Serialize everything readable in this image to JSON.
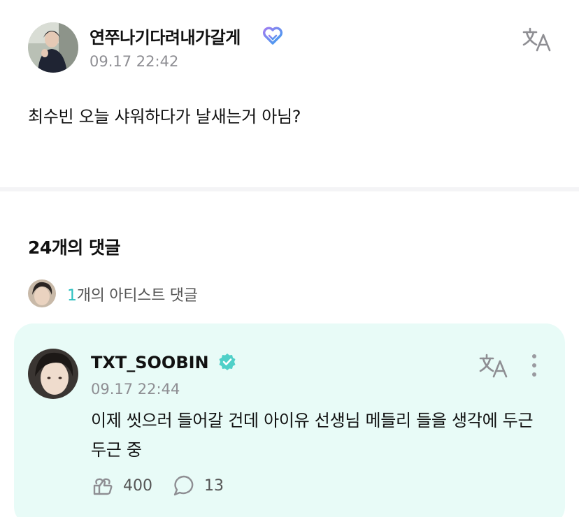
{
  "post": {
    "author": "연쭈나기다려내가갈게",
    "timestamp": "09.17 22:42",
    "body": "최수빈 오늘 샤워하다가 날새는거 아님?"
  },
  "comments": {
    "count_label": "24개의 댓글",
    "artist_summary": {
      "count": "1",
      "label": "개의 아티스트 댓글"
    },
    "featured": {
      "author": "TXT_SOOBIN",
      "timestamp": "09.17 22:44",
      "text": "이제 씻으러 들어갈 건데 아이유 선생님 메들리 들을 생각에 두근두근 중",
      "likes": "400",
      "replies": "13"
    }
  },
  "icons": {
    "badge": "heart-badge-icon",
    "verified": "verified-check-icon",
    "translate": "translate-icon",
    "more": "more-vertical-icon",
    "like": "like-icon",
    "reply": "reply-bubble-icon"
  },
  "colors": {
    "accent": "#2bbfbf",
    "verified": "#4fd0c8",
    "card_background": "#e8fbf7",
    "muted_text": "#8e8e93"
  }
}
